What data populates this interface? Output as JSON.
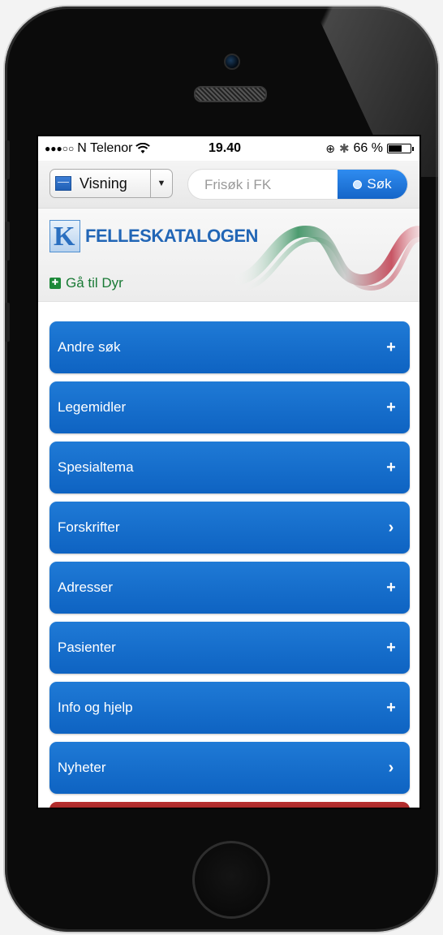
{
  "status": {
    "carrier": "N Telenor",
    "time": "19.40",
    "battery_percent": "66 %",
    "battery_level": 0.66
  },
  "toolbar": {
    "view_label": "Visning",
    "search_placeholder": "Frisøk i FK",
    "search_button": "Søk"
  },
  "banner": {
    "logo_text": "FELLESKATALOGEN",
    "goto_label": "Gå til Dyr"
  },
  "menu": {
    "items": [
      {
        "label": "Andre søk",
        "icon": "+"
      },
      {
        "label": "Legemidler",
        "icon": "+"
      },
      {
        "label": "Spesialtema",
        "icon": "+"
      },
      {
        "label": "Forskrifter",
        "icon": "›"
      },
      {
        "label": "Adresser",
        "icon": "+"
      },
      {
        "label": "Pasienter",
        "icon": "+"
      },
      {
        "label": "Info og hjelp",
        "icon": "+"
      },
      {
        "label": "Nyheter",
        "icon": "›"
      }
    ]
  },
  "colors": {
    "menu_blue": "#1570cc",
    "green_link": "#1a7a36",
    "logo_blue": "#2266b6",
    "red_strip": "#a52727"
  }
}
